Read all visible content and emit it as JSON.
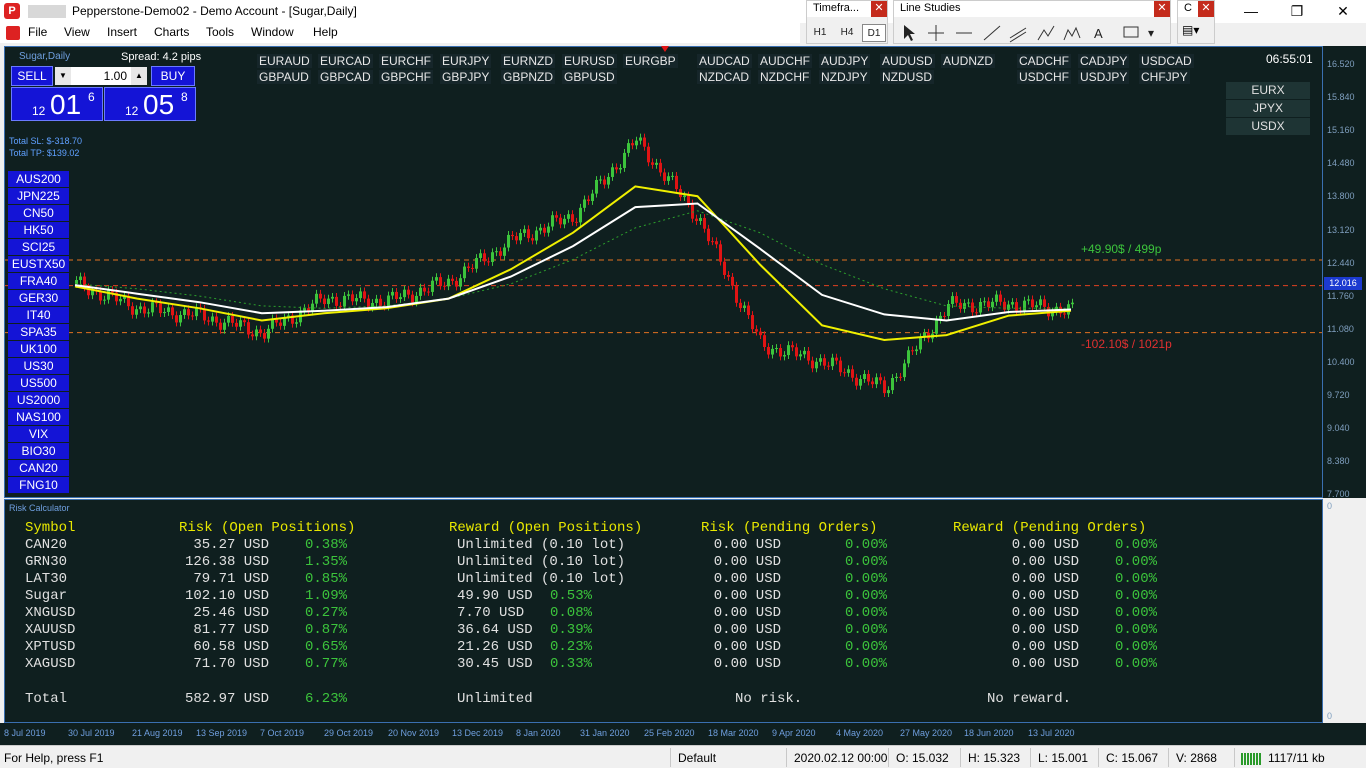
{
  "window": {
    "title": "Pepperstone-Demo02 - Demo Account - [Sugar,Daily]",
    "minimize": "—",
    "maximize": "❐",
    "close": "✕"
  },
  "menu": [
    "File",
    "View",
    "Insert",
    "Charts",
    "Tools",
    "Window",
    "Help"
  ],
  "timeframes_panel": {
    "title": "Timefra...",
    "buttons": [
      "H1",
      "H4",
      "D1"
    ]
  },
  "line_studies_panel": {
    "title": "Line Studies"
  },
  "chart": {
    "symbol_label": "Sugar,Daily",
    "spread": "Spread: 4.2 pips",
    "time": "06:55:01",
    "sell_label": "SELL",
    "buy_label": "BUY",
    "lot_value": "1.00",
    "sell_price_small": "12",
    "sell_price_big": "01",
    "sell_price_sup": "6",
    "buy_price_small": "12",
    "buy_price_big": "05",
    "buy_price_sup": "8",
    "total_sl": "Total SL: $-318.70",
    "total_tp": "Total TP: $139.02",
    "tp_label": "+49.90$ / 499p",
    "sl_label": "-102.10$ / 1021p",
    "current_price": "12.016",
    "symbols": [
      "AUS200",
      "JPN225",
      "CN50",
      "HK50",
      "SCI25",
      "EUSTX50",
      "FRA40",
      "GER30",
      "IT40",
      "SPA35",
      "UK100",
      "US30",
      "US500",
      "US2000",
      "NAS100",
      "VIX",
      "BIO30",
      "CAN20",
      "FNG10"
    ],
    "pairs_row1a": [
      "EURAUD",
      "EURCAD",
      "EURCHF",
      "EURJPY",
      "EURNZD",
      "EURUSD",
      "EURGBP"
    ],
    "pairs_row2a": [
      "GBPAUD",
      "GBPCAD",
      "GBPCHF",
      "GBPJPY",
      "GBPNZD",
      "GBPUSD"
    ],
    "pairs_row1b": [
      "AUDCAD",
      "AUDCHF",
      "AUDJPY",
      "AUDUSD",
      "AUDNZD"
    ],
    "pairs_row2b": [
      "NZDCAD",
      "NZDCHF",
      "NZDJPY",
      "NZDUSD"
    ],
    "pairs_row1c": [
      "CADCHF",
      "CADJPY",
      "USDCAD"
    ],
    "pairs_row2c": [
      "USDCHF",
      "USDJPY",
      "CHFJPY"
    ],
    "indices": [
      "EURX",
      "JPYX",
      "USDX"
    ],
    "y_ticks": [
      "16.520",
      "15.840",
      "15.160",
      "14.480",
      "13.800",
      "13.120",
      "12.440",
      "11.760",
      "11.080",
      "10.400",
      "9.720",
      "9.040",
      "8.380",
      "7.700"
    ],
    "x_ticks": [
      "8 Jul 2019",
      "30 Jul 2019",
      "21 Aug 2019",
      "13 Sep 2019",
      "7 Oct 2019",
      "29 Oct 2019",
      "20 Nov 2019",
      "13 Dec 2019",
      "8 Jan 2020",
      "31 Jan 2020",
      "25 Feb 2020",
      "18 Mar 2020",
      "9 Apr 2020",
      "4 May 2020",
      "27 May 2020",
      "18 Jun 2020",
      "13 Jul 2020"
    ],
    "colors": {
      "up": "#3cc43c",
      "down": "#e01414",
      "ma_fast": "#f0f000",
      "ma_slow": "#ffffff",
      "ma_dotted": "#2ca02c",
      "tp_line": "#e07020",
      "sl_line": "#e07020"
    }
  },
  "chart_data": {
    "type": "line",
    "title": "Sugar,Daily",
    "x": [
      "2019-07-08",
      "2019-07-30",
      "2019-08-21",
      "2019-09-13",
      "2019-10-07",
      "2019-10-29",
      "2019-11-20",
      "2019-12-13",
      "2020-01-08",
      "2020-01-31",
      "2020-02-25",
      "2020-03-18",
      "2020-04-09",
      "2020-05-04",
      "2020-05-27",
      "2020-06-18",
      "2020-07-13"
    ],
    "series": [
      {
        "values": [
          12.05,
          11.55,
          11.4,
          11.05,
          11.75,
          11.7,
          12.1,
          12.95,
          13.45,
          15.0,
          13.4,
          10.8,
          10.45,
          9.9,
          11.6,
          11.65,
          11.5
        ]
      },
      {
        "values": [
          12.0,
          11.75,
          11.55,
          11.3,
          11.45,
          11.55,
          11.75,
          12.35,
          13.1,
          14.05,
          13.85,
          12.45,
          11.2,
          10.9,
          11.0,
          11.4,
          11.5
        ]
      },
      {
        "values": [
          12.05,
          11.95,
          11.8,
          11.6,
          11.55,
          11.6,
          11.75,
          12.05,
          12.55,
          13.2,
          13.55,
          13.1,
          12.45,
          11.95,
          11.6,
          11.55,
          11.55
        ]
      }
    ],
    "ylim": [
      7.7,
      16.52
    ]
  },
  "risk": {
    "caption": "Risk Calculator",
    "headers": [
      "Symbol",
      "Risk (Open Positions)",
      "Reward (Open Positions)",
      "Risk (Pending Orders)",
      "Reward (Pending Orders)"
    ],
    "rows": [
      [
        "CAN20",
        "35.27 USD",
        "0.38%",
        "Unlimited (0.10 lot)",
        "",
        "0.00 USD",
        "0.00%",
        "0.00 USD",
        "0.00%"
      ],
      [
        "GRN30",
        "126.38 USD",
        "1.35%",
        "Unlimited (0.10 lot)",
        "",
        "0.00 USD",
        "0.00%",
        "0.00 USD",
        "0.00%"
      ],
      [
        "LAT30",
        "79.71 USD",
        "0.85%",
        "Unlimited (0.10 lot)",
        "",
        "0.00 USD",
        "0.00%",
        "0.00 USD",
        "0.00%"
      ],
      [
        "Sugar",
        "102.10 USD",
        "1.09%",
        "49.90 USD",
        "0.53%",
        "0.00 USD",
        "0.00%",
        "0.00 USD",
        "0.00%"
      ],
      [
        "XNGUSD",
        "25.46 USD",
        "0.27%",
        "7.70 USD",
        "0.08%",
        "0.00 USD",
        "0.00%",
        "0.00 USD",
        "0.00%"
      ],
      [
        "XAUUSD",
        "81.77 USD",
        "0.87%",
        "36.64 USD",
        "0.39%",
        "0.00 USD",
        "0.00%",
        "0.00 USD",
        "0.00%"
      ],
      [
        "XPTUSD",
        "60.58 USD",
        "0.65%",
        "21.26 USD",
        "0.23%",
        "0.00 USD",
        "0.00%",
        "0.00 USD",
        "0.00%"
      ],
      [
        "XAGUSD",
        "71.70 USD",
        "0.77%",
        "30.45 USD",
        "0.33%",
        "0.00 USD",
        "0.00%",
        "0.00 USD",
        "0.00%"
      ]
    ],
    "total": [
      "Total",
      "582.97 USD",
      "6.23%",
      "Unlimited",
      "No risk.",
      "No reward."
    ],
    "axis_top": "0",
    "axis_bottom": "0"
  },
  "status": {
    "help": "For Help, press F1",
    "profile": "Default",
    "datetime": "2020.02.12 00:00",
    "open": "O: 15.032",
    "high": "H: 15.323",
    "low": "L: 15.001",
    "close": "C: 15.067",
    "volume": "V: 2868",
    "traffic": "1117/11 kb"
  }
}
